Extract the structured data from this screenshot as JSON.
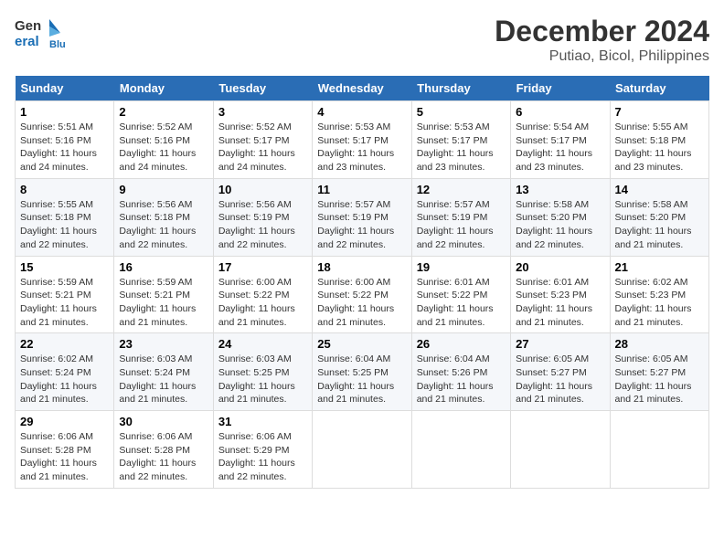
{
  "logo": {
    "name_part1": "General",
    "name_part2": "Blue"
  },
  "title": "December 2024",
  "subtitle": "Putiao, Bicol, Philippines",
  "weekdays": [
    "Sunday",
    "Monday",
    "Tuesday",
    "Wednesday",
    "Thursday",
    "Friday",
    "Saturday"
  ],
  "weeks": [
    [
      {
        "day": "1",
        "sunrise": "5:51 AM",
        "sunset": "5:16 PM",
        "daylight": "11 hours and 24 minutes."
      },
      {
        "day": "2",
        "sunrise": "5:52 AM",
        "sunset": "5:16 PM",
        "daylight": "11 hours and 24 minutes."
      },
      {
        "day": "3",
        "sunrise": "5:52 AM",
        "sunset": "5:17 PM",
        "daylight": "11 hours and 24 minutes."
      },
      {
        "day": "4",
        "sunrise": "5:53 AM",
        "sunset": "5:17 PM",
        "daylight": "11 hours and 23 minutes."
      },
      {
        "day": "5",
        "sunrise": "5:53 AM",
        "sunset": "5:17 PM",
        "daylight": "11 hours and 23 minutes."
      },
      {
        "day": "6",
        "sunrise": "5:54 AM",
        "sunset": "5:17 PM",
        "daylight": "11 hours and 23 minutes."
      },
      {
        "day": "7",
        "sunrise": "5:55 AM",
        "sunset": "5:18 PM",
        "daylight": "11 hours and 23 minutes."
      }
    ],
    [
      {
        "day": "8",
        "sunrise": "5:55 AM",
        "sunset": "5:18 PM",
        "daylight": "11 hours and 22 minutes."
      },
      {
        "day": "9",
        "sunrise": "5:56 AM",
        "sunset": "5:18 PM",
        "daylight": "11 hours and 22 minutes."
      },
      {
        "day": "10",
        "sunrise": "5:56 AM",
        "sunset": "5:19 PM",
        "daylight": "11 hours and 22 minutes."
      },
      {
        "day": "11",
        "sunrise": "5:57 AM",
        "sunset": "5:19 PM",
        "daylight": "11 hours and 22 minutes."
      },
      {
        "day": "12",
        "sunrise": "5:57 AM",
        "sunset": "5:19 PM",
        "daylight": "11 hours and 22 minutes."
      },
      {
        "day": "13",
        "sunrise": "5:58 AM",
        "sunset": "5:20 PM",
        "daylight": "11 hours and 22 minutes."
      },
      {
        "day": "14",
        "sunrise": "5:58 AM",
        "sunset": "5:20 PM",
        "daylight": "11 hours and 21 minutes."
      }
    ],
    [
      {
        "day": "15",
        "sunrise": "5:59 AM",
        "sunset": "5:21 PM",
        "daylight": "11 hours and 21 minutes."
      },
      {
        "day": "16",
        "sunrise": "5:59 AM",
        "sunset": "5:21 PM",
        "daylight": "11 hours and 21 minutes."
      },
      {
        "day": "17",
        "sunrise": "6:00 AM",
        "sunset": "5:22 PM",
        "daylight": "11 hours and 21 minutes."
      },
      {
        "day": "18",
        "sunrise": "6:00 AM",
        "sunset": "5:22 PM",
        "daylight": "11 hours and 21 minutes."
      },
      {
        "day": "19",
        "sunrise": "6:01 AM",
        "sunset": "5:22 PM",
        "daylight": "11 hours and 21 minutes."
      },
      {
        "day": "20",
        "sunrise": "6:01 AM",
        "sunset": "5:23 PM",
        "daylight": "11 hours and 21 minutes."
      },
      {
        "day": "21",
        "sunrise": "6:02 AM",
        "sunset": "5:23 PM",
        "daylight": "11 hours and 21 minutes."
      }
    ],
    [
      {
        "day": "22",
        "sunrise": "6:02 AM",
        "sunset": "5:24 PM",
        "daylight": "11 hours and 21 minutes."
      },
      {
        "day": "23",
        "sunrise": "6:03 AM",
        "sunset": "5:24 PM",
        "daylight": "11 hours and 21 minutes."
      },
      {
        "day": "24",
        "sunrise": "6:03 AM",
        "sunset": "5:25 PM",
        "daylight": "11 hours and 21 minutes."
      },
      {
        "day": "25",
        "sunrise": "6:04 AM",
        "sunset": "5:25 PM",
        "daylight": "11 hours and 21 minutes."
      },
      {
        "day": "26",
        "sunrise": "6:04 AM",
        "sunset": "5:26 PM",
        "daylight": "11 hours and 21 minutes."
      },
      {
        "day": "27",
        "sunrise": "6:05 AM",
        "sunset": "5:27 PM",
        "daylight": "11 hours and 21 minutes."
      },
      {
        "day": "28",
        "sunrise": "6:05 AM",
        "sunset": "5:27 PM",
        "daylight": "11 hours and 21 minutes."
      }
    ],
    [
      {
        "day": "29",
        "sunrise": "6:06 AM",
        "sunset": "5:28 PM",
        "daylight": "11 hours and 21 minutes."
      },
      {
        "day": "30",
        "sunrise": "6:06 AM",
        "sunset": "5:28 PM",
        "daylight": "11 hours and 22 minutes."
      },
      {
        "day": "31",
        "sunrise": "6:06 AM",
        "sunset": "5:29 PM",
        "daylight": "11 hours and 22 minutes."
      },
      null,
      null,
      null,
      null
    ]
  ],
  "labels": {
    "sunrise": "Sunrise:",
    "sunset": "Sunset:",
    "daylight": "Daylight:"
  }
}
